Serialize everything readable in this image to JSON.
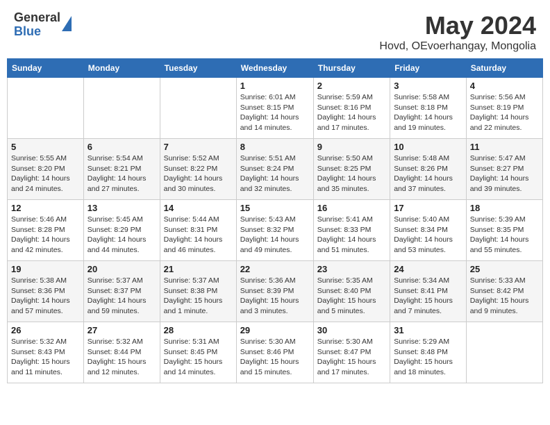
{
  "header": {
    "logo_general": "General",
    "logo_blue": "Blue",
    "title": "May 2024",
    "location": "Hovd, OEvoerhangay, Mongolia"
  },
  "calendar": {
    "days_of_week": [
      "Sunday",
      "Monday",
      "Tuesday",
      "Wednesday",
      "Thursday",
      "Friday",
      "Saturday"
    ],
    "weeks": [
      [
        {
          "day": "",
          "info": ""
        },
        {
          "day": "",
          "info": ""
        },
        {
          "day": "",
          "info": ""
        },
        {
          "day": "1",
          "info": "Sunrise: 6:01 AM\nSunset: 8:15 PM\nDaylight: 14 hours\nand 14 minutes."
        },
        {
          "day": "2",
          "info": "Sunrise: 5:59 AM\nSunset: 8:16 PM\nDaylight: 14 hours\nand 17 minutes."
        },
        {
          "day": "3",
          "info": "Sunrise: 5:58 AM\nSunset: 8:18 PM\nDaylight: 14 hours\nand 19 minutes."
        },
        {
          "day": "4",
          "info": "Sunrise: 5:56 AM\nSunset: 8:19 PM\nDaylight: 14 hours\nand 22 minutes."
        }
      ],
      [
        {
          "day": "5",
          "info": "Sunrise: 5:55 AM\nSunset: 8:20 PM\nDaylight: 14 hours\nand 24 minutes."
        },
        {
          "day": "6",
          "info": "Sunrise: 5:54 AM\nSunset: 8:21 PM\nDaylight: 14 hours\nand 27 minutes."
        },
        {
          "day": "7",
          "info": "Sunrise: 5:52 AM\nSunset: 8:22 PM\nDaylight: 14 hours\nand 30 minutes."
        },
        {
          "day": "8",
          "info": "Sunrise: 5:51 AM\nSunset: 8:24 PM\nDaylight: 14 hours\nand 32 minutes."
        },
        {
          "day": "9",
          "info": "Sunrise: 5:50 AM\nSunset: 8:25 PM\nDaylight: 14 hours\nand 35 minutes."
        },
        {
          "day": "10",
          "info": "Sunrise: 5:48 AM\nSunset: 8:26 PM\nDaylight: 14 hours\nand 37 minutes."
        },
        {
          "day": "11",
          "info": "Sunrise: 5:47 AM\nSunset: 8:27 PM\nDaylight: 14 hours\nand 39 minutes."
        }
      ],
      [
        {
          "day": "12",
          "info": "Sunrise: 5:46 AM\nSunset: 8:28 PM\nDaylight: 14 hours\nand 42 minutes."
        },
        {
          "day": "13",
          "info": "Sunrise: 5:45 AM\nSunset: 8:29 PM\nDaylight: 14 hours\nand 44 minutes."
        },
        {
          "day": "14",
          "info": "Sunrise: 5:44 AM\nSunset: 8:31 PM\nDaylight: 14 hours\nand 46 minutes."
        },
        {
          "day": "15",
          "info": "Sunrise: 5:43 AM\nSunset: 8:32 PM\nDaylight: 14 hours\nand 49 minutes."
        },
        {
          "day": "16",
          "info": "Sunrise: 5:41 AM\nSunset: 8:33 PM\nDaylight: 14 hours\nand 51 minutes."
        },
        {
          "day": "17",
          "info": "Sunrise: 5:40 AM\nSunset: 8:34 PM\nDaylight: 14 hours\nand 53 minutes."
        },
        {
          "day": "18",
          "info": "Sunrise: 5:39 AM\nSunset: 8:35 PM\nDaylight: 14 hours\nand 55 minutes."
        }
      ],
      [
        {
          "day": "19",
          "info": "Sunrise: 5:38 AM\nSunset: 8:36 PM\nDaylight: 14 hours\nand 57 minutes."
        },
        {
          "day": "20",
          "info": "Sunrise: 5:37 AM\nSunset: 8:37 PM\nDaylight: 14 hours\nand 59 minutes."
        },
        {
          "day": "21",
          "info": "Sunrise: 5:37 AM\nSunset: 8:38 PM\nDaylight: 15 hours\nand 1 minute."
        },
        {
          "day": "22",
          "info": "Sunrise: 5:36 AM\nSunset: 8:39 PM\nDaylight: 15 hours\nand 3 minutes."
        },
        {
          "day": "23",
          "info": "Sunrise: 5:35 AM\nSunset: 8:40 PM\nDaylight: 15 hours\nand 5 minutes."
        },
        {
          "day": "24",
          "info": "Sunrise: 5:34 AM\nSunset: 8:41 PM\nDaylight: 15 hours\nand 7 minutes."
        },
        {
          "day": "25",
          "info": "Sunrise: 5:33 AM\nSunset: 8:42 PM\nDaylight: 15 hours\nand 9 minutes."
        }
      ],
      [
        {
          "day": "26",
          "info": "Sunrise: 5:32 AM\nSunset: 8:43 PM\nDaylight: 15 hours\nand 11 minutes."
        },
        {
          "day": "27",
          "info": "Sunrise: 5:32 AM\nSunset: 8:44 PM\nDaylight: 15 hours\nand 12 minutes."
        },
        {
          "day": "28",
          "info": "Sunrise: 5:31 AM\nSunset: 8:45 PM\nDaylight: 15 hours\nand 14 minutes."
        },
        {
          "day": "29",
          "info": "Sunrise: 5:30 AM\nSunset: 8:46 PM\nDaylight: 15 hours\nand 15 minutes."
        },
        {
          "day": "30",
          "info": "Sunrise: 5:30 AM\nSunset: 8:47 PM\nDaylight: 15 hours\nand 17 minutes."
        },
        {
          "day": "31",
          "info": "Sunrise: 5:29 AM\nSunset: 8:48 PM\nDaylight: 15 hours\nand 18 minutes."
        },
        {
          "day": "",
          "info": ""
        }
      ]
    ]
  }
}
